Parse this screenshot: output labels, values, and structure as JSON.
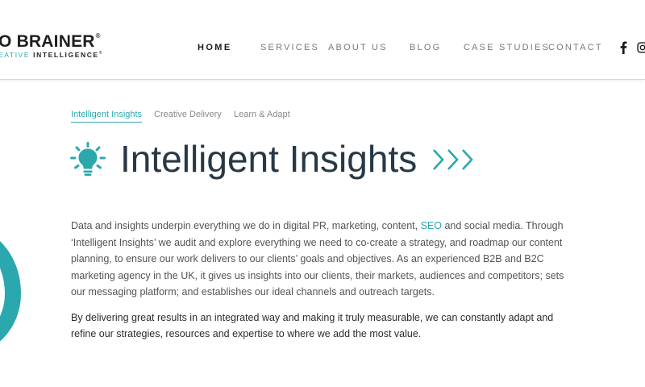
{
  "header": {
    "logo": {
      "main": "O BRAINER",
      "sub_teal": "EATIVE",
      "sub_dark": "INTELLIGENCE",
      "reg_mark": "®"
    },
    "nav": [
      {
        "label": "HOME",
        "active": true
      },
      {
        "label": "SERVICES",
        "active": false
      },
      {
        "label": "ABOUT US",
        "active": false
      },
      {
        "label": "BLOG",
        "active": false
      },
      {
        "label": "CASE STUDIES",
        "active": false
      },
      {
        "label": "CONTACT",
        "active": false
      }
    ],
    "social": [
      "facebook-icon",
      "instagram-icon"
    ]
  },
  "tabs": [
    {
      "label": "Intelligent Insights",
      "active": true
    },
    {
      "label": "Creative Delivery",
      "active": false
    },
    {
      "label": "Learn & Adapt",
      "active": false
    }
  ],
  "section": {
    "icon": "lightbulb-icon",
    "title": "Intelligent Insights",
    "title_suffix_icon": "triple-chevron-icon"
  },
  "body": {
    "para1_before_link": "Data and insights underpin everything we do in digital PR, marketing, content, ",
    "para1_link": "SEO",
    "para1_after_link": " and social media. Through ‘Intelligent Insights’ we audit and explore everything we need to co-create a strategy, and roadmap our content planning, to ensure our work delivers to our clients’ goals and objectives. As an experienced B2B and B2C marketing agency in the UK, it gives us insights into our clients, their markets, audiences and competitors; sets our messaging platform; and establishes our ideal channels and outreach targets.",
    "para2": "By delivering great results in an integrated way and making it truly measurable, we can constantly adapt and refine our strategies, resources and expertise to where we add the most value."
  },
  "colors": {
    "accent": "#2aa8ad",
    "title": "#283845",
    "text": "#545454"
  }
}
